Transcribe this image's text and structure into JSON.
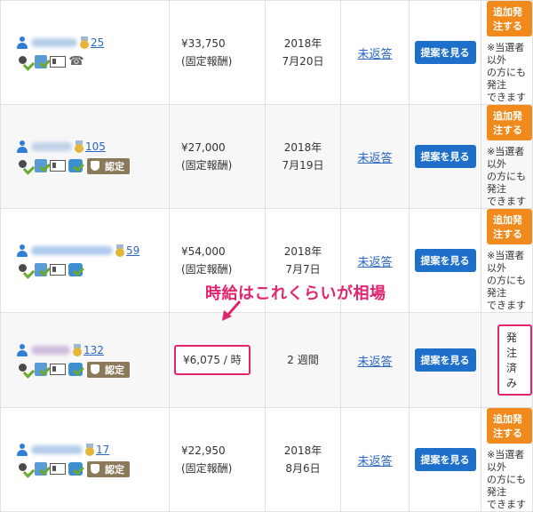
{
  "rows": [
    {
      "name_colors": [
        "#a8c6e6",
        "#c3d7ef"
      ],
      "rating": "25",
      "price": "¥33,750",
      "price_type": "(固定報酬)",
      "date_line1": "2018年",
      "date_line2": "7月20日",
      "status": "未返答",
      "view_label": "提案を見る",
      "order_label": "追加発注する",
      "note_l1": "※当選者以外",
      "note_l2": "の方にも発注",
      "note_l3": "できます",
      "badges": [
        "person-check",
        "doc-check",
        "card",
        "phone"
      ],
      "certified": false,
      "alt": false
    },
    {
      "name_colors": [
        "#b7cbe6",
        "#a9c0e0"
      ],
      "rating": "105",
      "price": "¥27,000",
      "price_type": "(固定報酬)",
      "date_line1": "2018年",
      "date_line2": "7月19日",
      "status": "未返答",
      "view_label": "提案を見る",
      "order_label": "追加発注する",
      "note_l1": "※当選者以外",
      "note_l2": "の方にも発注",
      "note_l3": "できます",
      "badges": [
        "person-check",
        "doc-check",
        "card",
        "id-check"
      ],
      "certified": true,
      "cert_label": "認定",
      "alt": true
    },
    {
      "name_colors": [
        "#9fc0ea",
        "#b4cfee"
      ],
      "rating": "59",
      "price": "¥54,000",
      "price_type": "(固定報酬)",
      "date_line1": "2018年",
      "date_line2": "7月7日",
      "status": "未返答",
      "view_label": "提案を見る",
      "order_label": "追加発注する",
      "note_l1": "※当選者以外",
      "note_l2": "の方にも発注",
      "note_l3": "できます",
      "badges": [
        "person-check",
        "doc-check",
        "card",
        "id-check"
      ],
      "certified": false,
      "alt": false
    },
    {
      "name_colors": [
        "#c7b3d9",
        "#b9a6cf"
      ],
      "rating": "132",
      "price": "¥6,075 / 時",
      "duration": "2 週間",
      "status": "未返答",
      "view_label": "提案を見る",
      "ordered_label": "発注済み",
      "badges": [
        "person-check",
        "doc-check",
        "card",
        "id-check"
      ],
      "certified": true,
      "cert_label": "認定",
      "alt": true
    },
    {
      "name_colors": [
        "#a6c4e8",
        "#b8d1ee"
      ],
      "rating": "17",
      "price": "¥22,950",
      "price_type": "(固定報酬)",
      "date_line1": "2018年",
      "date_line2": "8月6日",
      "status": "未返答",
      "view_label": "提案を見る",
      "order_label": "追加発注する",
      "note_l1": "※当選者以外",
      "note_l2": "の方にも発注",
      "note_l3": "できます",
      "badges": [
        "person-check",
        "doc-check",
        "card",
        "id-check"
      ],
      "certified": true,
      "cert_label": "認定",
      "alt": false
    }
  ],
  "annotation": {
    "text": "時給はこれくらいが相場",
    "color": "#e2246e"
  },
  "colors": {
    "link": "#2a66c4",
    "view_button": "#1e6fc9",
    "order_button": "#f08a1c",
    "highlight": "#e2246e",
    "cert": "#8a7a5a"
  }
}
